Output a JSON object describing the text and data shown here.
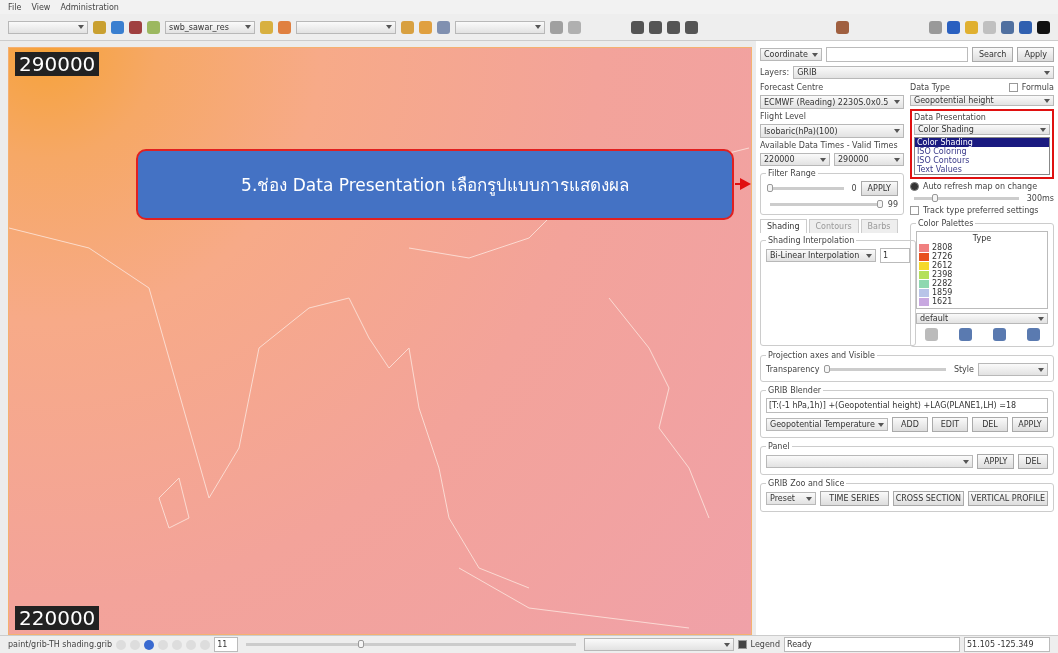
{
  "menu": [
    "File",
    "View",
    "Administration"
  ],
  "toolbar": {
    "layer_combo": "swb_sawar_res"
  },
  "map": {
    "top_label": "290000",
    "bottom_label": "220000"
  },
  "callout": {
    "text": "5.ช่อง Data Presentation เลือกรูปแบบการแสดงผล"
  },
  "search_row": {
    "mode": "Coordinate",
    "search": "Search",
    "apply": "Apply"
  },
  "layers": {
    "label": "Layers:",
    "value": "GRIB"
  },
  "forecast": {
    "label": "Forecast Centre",
    "value": "ECMWF (Reading) 2230S.0x0.5"
  },
  "data_type": {
    "label": "Data Type",
    "value": "Geopotential height",
    "formula": {
      "label": "Formula",
      "checked": false
    }
  },
  "flight": {
    "label": "Flight Level",
    "value": "Isobaric(hPa)(100)"
  },
  "presentation": {
    "label": "Data Presentation",
    "value": "Color Shading",
    "options": [
      {
        "label": "Color Shading",
        "selected": true
      },
      {
        "label": "ISO Coloring",
        "selected": false
      },
      {
        "label": "ISO Contours",
        "selected": false
      },
      {
        "label": "Text Values",
        "selected": false
      }
    ]
  },
  "times": {
    "label": "Available Data Times - Valid Times",
    "from": "220000",
    "to": "290000"
  },
  "auto_refresh": {
    "label": "Auto refresh map on change",
    "selected": true,
    "delay": "300ms",
    "level": 0.2
  },
  "track": {
    "label": "Track type preferred settings",
    "checked": false
  },
  "filter": {
    "label": "Filter Range",
    "apply": "APPLY",
    "sliders": [
      {
        "value": "0",
        "level": 0
      },
      {
        "value": "99",
        "level": 1
      }
    ]
  },
  "tabs": [
    {
      "label": "Shading",
      "selected": true
    },
    {
      "label": "Contours",
      "selected": false
    },
    {
      "label": "Barbs",
      "selected": false
    }
  ],
  "shading": {
    "label": "Shading Interpolation",
    "method": "Bi-Linear Interpolation",
    "step": "1"
  },
  "palettes": {
    "label": "Color Palettes",
    "header": "Type",
    "palette": "default",
    "items": [
      {
        "value": "2808",
        "color": "#f08080"
      },
      {
        "value": "2726",
        "color": "#e8501e"
      },
      {
        "value": "2612",
        "color": "#f5d82a"
      },
      {
        "value": "2398",
        "color": "#b4e05a"
      },
      {
        "value": "2282",
        "color": "#8ed8b0"
      },
      {
        "value": "1859",
        "color": "#b8c4e8"
      },
      {
        "value": "1621",
        "color": "#c8a8e0"
      }
    ]
  },
  "projection": {
    "label": "Projection axes and Visible",
    "transparency": "Transparency",
    "level": 0,
    "style": "Style"
  },
  "blender": {
    "label": "GRIB Blender",
    "formula": "[T:(-1 hPa,1h)] +(Geopotential height) +LAG(PLANE1,LH) =18",
    "method": "Geopotential Temperature",
    "buttons": [
      "ADD",
      "EDIT",
      "DEL",
      "APPLY"
    ]
  },
  "panel": {
    "label": "Panel",
    "buttons": [
      "APPLY",
      "DEL"
    ]
  },
  "zoom_slice": {
    "label": "GRIB Zoo and Slice",
    "preset": "Preset",
    "buttons": [
      "TIME SERIES",
      "CROSS SECTION",
      "VERTICAL PROFILE"
    ]
  },
  "status_bar": {
    "path": "paint/grib-TH shading.grib",
    "zoom": "11",
    "time_slider": {
      "level": 0.35
    },
    "legend": {
      "label": "Legend",
      "checked": true
    },
    "message": "Ready",
    "coords": "51.105 -125.349"
  }
}
